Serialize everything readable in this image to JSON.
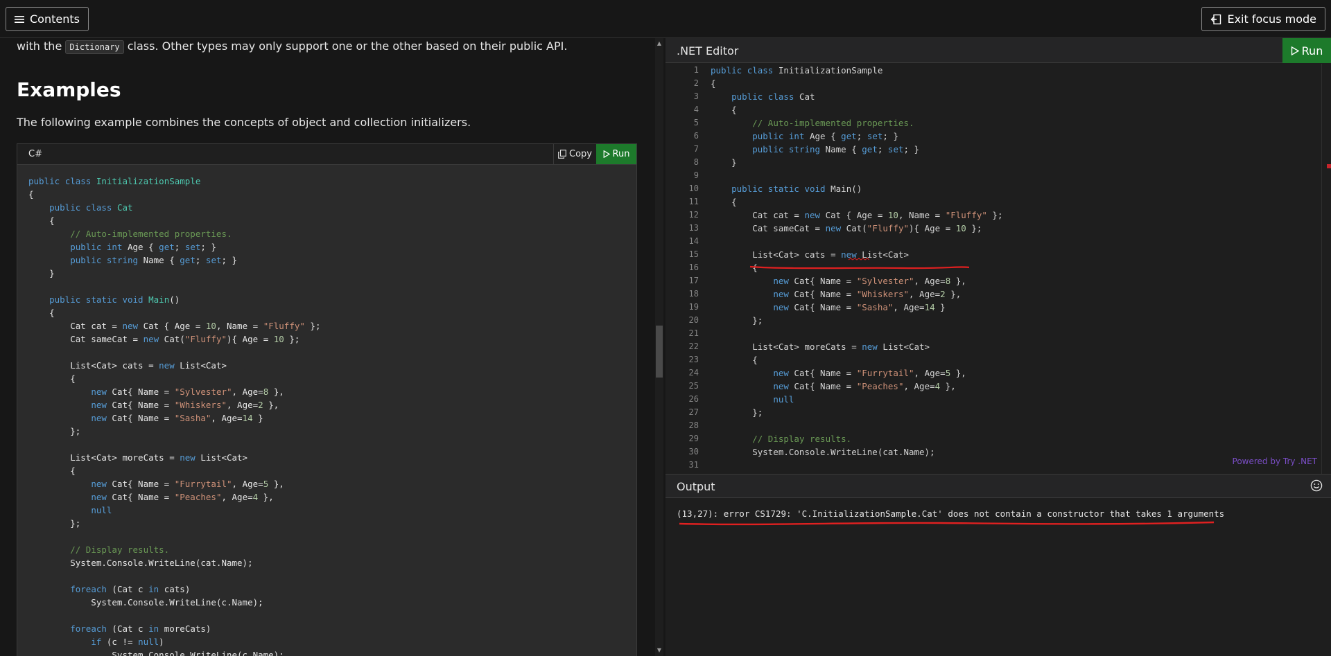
{
  "topbar": {
    "contents_label": "Contents",
    "exit_focus_label": "Exit focus mode"
  },
  "doc": {
    "intro_before": "with the",
    "intro_code": "Dictionary",
    "intro_after": "class. Other types may only support one or the other based on their public API.",
    "heading": "Examples",
    "paragraph": "The following example combines the concepts of object and collection initializers.",
    "code_lang": "C#",
    "copy_label": "Copy",
    "run_label": "Run"
  },
  "editor": {
    "title": ".NET Editor",
    "run_label": "Run",
    "powered_by": "Powered by Try .NET",
    "line_count": 31
  },
  "output": {
    "title": "Output",
    "message": "(13,27): error CS1729: 'C.InitializationSample.Cat' does not contain a constructor that takes 1 arguments"
  },
  "colors": {
    "run_green": "#1d7a2b",
    "annotation_red": "#e02020",
    "powered_purple": "#7b4ec7"
  }
}
